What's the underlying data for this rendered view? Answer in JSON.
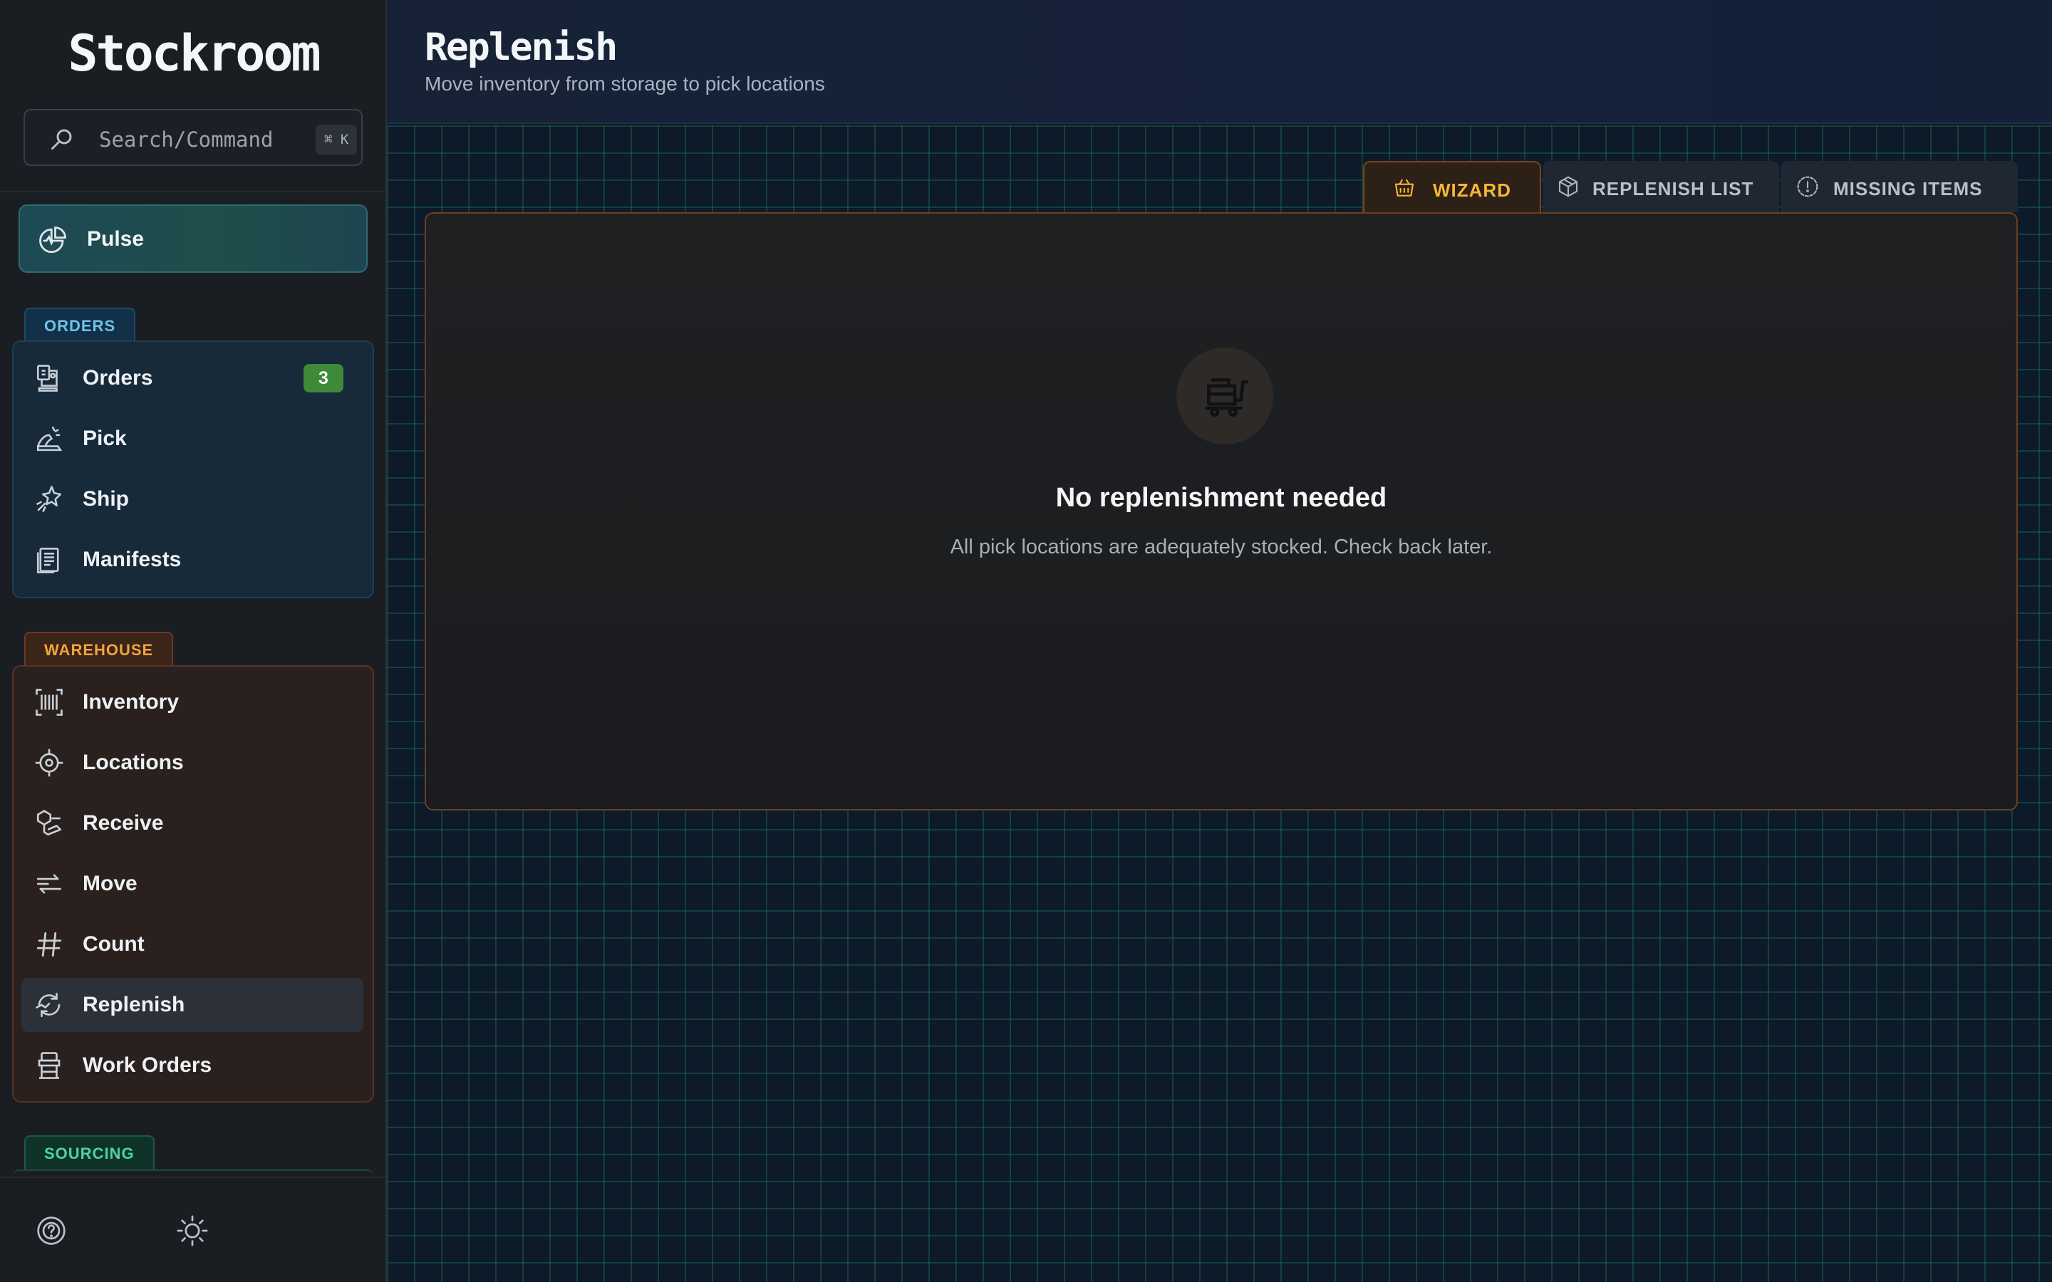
{
  "app": {
    "brand": "Stockroom"
  },
  "search": {
    "placeholder": "Search/Command",
    "shortcut": "⌘ K"
  },
  "sidebar": {
    "pulse": {
      "label": "Pulse",
      "icon": "pulse-chart-icon"
    },
    "groups": [
      {
        "title": "ORDERS",
        "color": "#6fc2ea",
        "items": [
          {
            "label": "Orders",
            "icon": "orders-icon",
            "badge": "3"
          },
          {
            "label": "Pick",
            "icon": "pick-icon"
          },
          {
            "label": "Ship",
            "icon": "ship-icon"
          },
          {
            "label": "Manifests",
            "icon": "manifest-icon"
          }
        ]
      },
      {
        "title": "WAREHOUSE",
        "color": "#f0a43e",
        "items": [
          {
            "label": "Inventory",
            "icon": "barcode-icon"
          },
          {
            "label": "Locations",
            "icon": "crosshair-icon"
          },
          {
            "label": "Receive",
            "icon": "receive-icon"
          },
          {
            "label": "Move",
            "icon": "move-arrows-icon"
          },
          {
            "label": "Count",
            "icon": "hash-icon"
          },
          {
            "label": "Replenish",
            "icon": "replenish-icon",
            "active": true
          },
          {
            "label": "Work Orders",
            "icon": "work-orders-icon"
          }
        ]
      },
      {
        "title": "SOURCING",
        "color": "#4fd3a0",
        "items": []
      }
    ],
    "footer": {
      "help_icon": "help-icon",
      "theme_icon": "sun-icon"
    }
  },
  "header": {
    "title": "Replenish",
    "subtitle": "Move inventory from storage to pick locations"
  },
  "tabs": [
    {
      "label": "WIZARD",
      "icon": "basket-icon",
      "active": true
    },
    {
      "label": "REPLENISH LIST",
      "icon": "box-icon",
      "active": false
    },
    {
      "label": "MISSING ITEMS",
      "icon": "alert-circle-icon",
      "active": false
    }
  ],
  "empty_state": {
    "icon": "cart-icon",
    "title": "No replenishment needed",
    "description": "All pick locations are adequately stocked. Check back later."
  },
  "colors": {
    "accent_orange": "#f4b635",
    "badge_green": "#3f8a39",
    "grid_line": "#1c6e46"
  }
}
